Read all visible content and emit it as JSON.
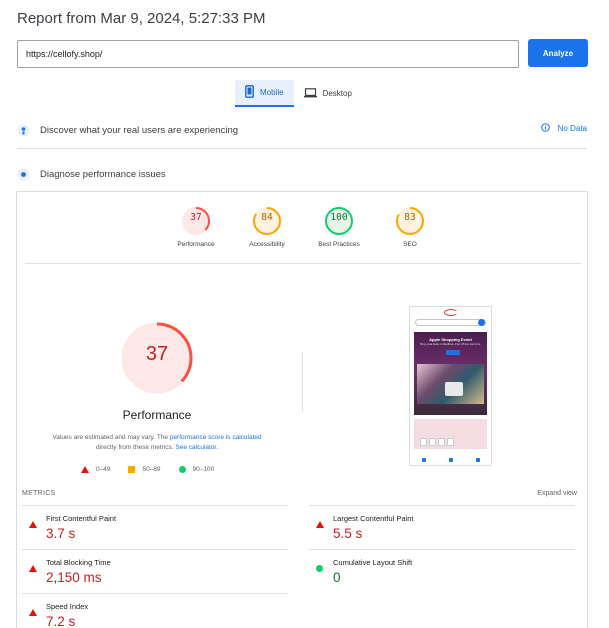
{
  "report_title": "Report from Mar 9, 2024, 5:27:33 PM",
  "url_input": {
    "value": "https://cellofy.shop/"
  },
  "analyze_label": "Analyze",
  "tabs": [
    {
      "label": "Mobile",
      "active": true,
      "icon": "smartphone-icon"
    },
    {
      "label": "Desktop",
      "active": false,
      "icon": "laptop-icon"
    }
  ],
  "field_data": {
    "title": "Discover what your real users are experiencing",
    "no_data_label": "No Data"
  },
  "diagnose": {
    "title": "Diagnose performance issues"
  },
  "categories": [
    {
      "label": "Performance",
      "score": "37",
      "color": "#c5221f",
      "bg": "#fce8e6",
      "arc": "#ff4e42"
    },
    {
      "label": "Accessibility",
      "score": "84",
      "color": "#b06000",
      "bg": "#fff3e0",
      "arc": "#ffa400"
    },
    {
      "label": "Best Practices",
      "score": "100",
      "color": "#137333",
      "bg": "#e6f4ea",
      "arc": "#0cce6b"
    },
    {
      "label": "SEO",
      "score": "83",
      "color": "#b06000",
      "bg": "#fff3e0",
      "arc": "#ffa400"
    }
  ],
  "main_gauge": {
    "score": "37",
    "label": "Performance",
    "estimate_prefix": "Values are estimated and may vary. The ",
    "estimate_link": "performance score is calculated",
    "estimate_middle": "directly from these metrics. ",
    "calc_link": "See calculator."
  },
  "legend": [
    {
      "range": "0–49",
      "shape": "triangle",
      "color": "#eb0f00"
    },
    {
      "range": "50–89",
      "shape": "square",
      "color": "#ffa400"
    },
    {
      "range": "90–100",
      "shape": "circle",
      "color": "#0cce6b"
    }
  ],
  "metrics_heading": "METRICS",
  "expand_label": "Expand view",
  "metrics": [
    {
      "name": "First Contentful Paint",
      "value": "3.7 s",
      "status": "bad"
    },
    {
      "name": "Largest Contentful Paint",
      "value": "5.5 s",
      "status": "bad"
    },
    {
      "name": "Total Blocking Time",
      "value": "2,150 ms",
      "status": "bad"
    },
    {
      "name": "Cumulative Layout Shift",
      "value": "0",
      "status": "good"
    },
    {
      "name": "Speed Index",
      "value": "7.2 s",
      "status": "bad"
    }
  ],
  "screenshot": {
    "hero_title": "Apple Shopping Event",
    "hero_subtitle": "Shop great deals on MacBook, iPad, iPhone and more."
  }
}
